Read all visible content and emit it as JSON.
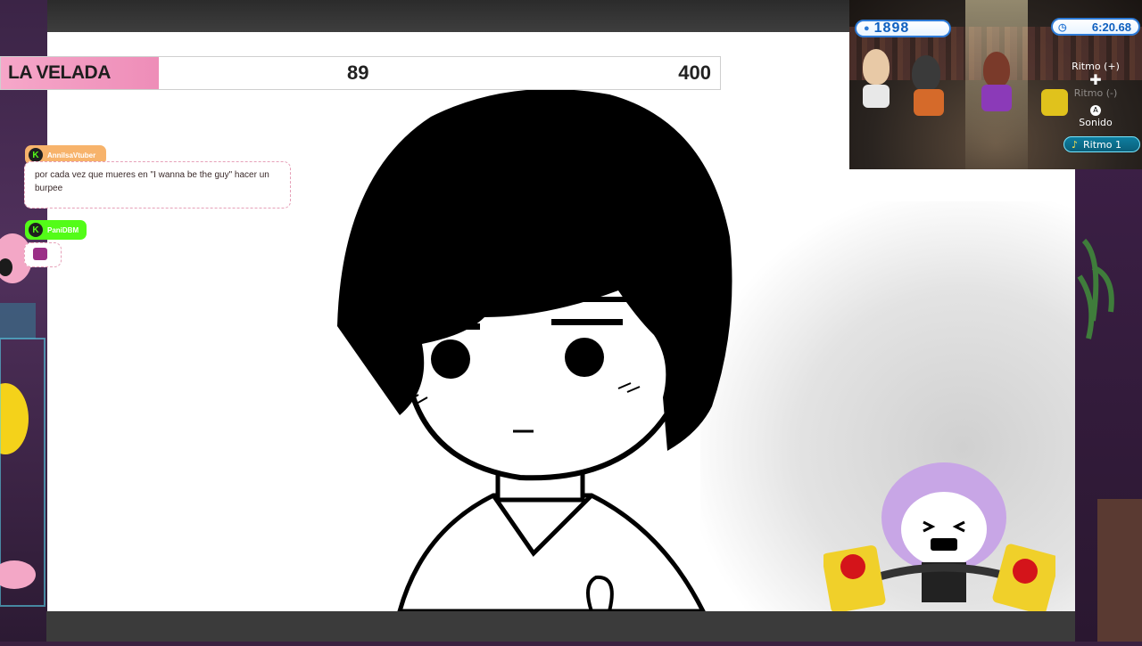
{
  "overlay": {
    "title": "LA VELADA",
    "current": "89",
    "goal": "400"
  },
  "chat": [
    {
      "username": "AnnilsaVtuber",
      "message": "por cada vez que mueres en \"I wanna be the guy\" hacer un burpee",
      "name_color": "#f7b36b"
    },
    {
      "username": "PaniDBM",
      "message": "",
      "name_color": "#53fc18"
    }
  ],
  "wii_game": {
    "score": "1898",
    "timer": "6:20.68",
    "ritmo_up": "Ritmo (+)",
    "ritmo_down": "Ritmo (-)",
    "sonido": "Sonido",
    "ritmo_level": "Ritmo 1"
  },
  "colors": {
    "velada_accent": "#f6a7c9",
    "chat_border": "#e6a0b8",
    "kick_green": "#53fc18",
    "wii_blue": "#2d7ad6"
  }
}
